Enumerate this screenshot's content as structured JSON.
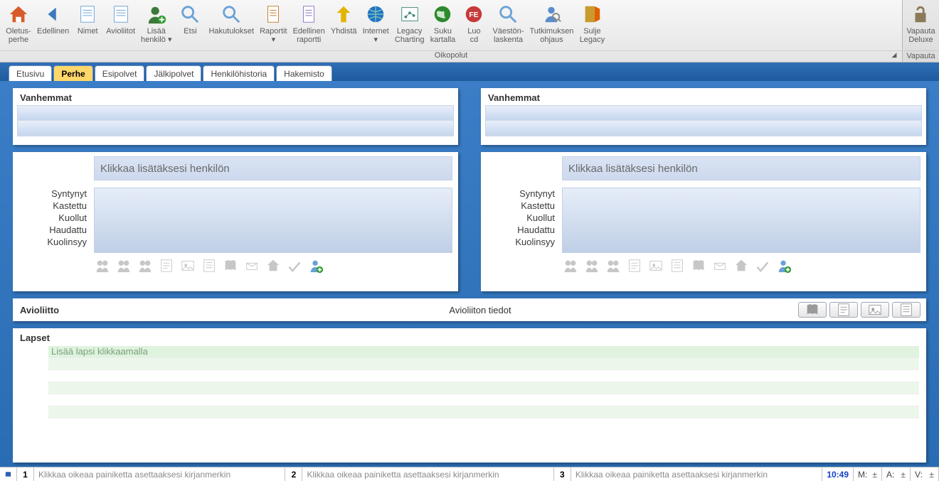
{
  "ribbon": {
    "items": [
      {
        "label": "Oletus-\nperhe",
        "icon": "home-icon",
        "fill": "#d85c2a"
      },
      {
        "label": "Edellinen",
        "icon": "back-arrow-icon",
        "fill": "#3a7abf"
      },
      {
        "label": "Nimet",
        "icon": "name-list-icon",
        "fill": "#6aa2d8"
      },
      {
        "label": "Avioliitot",
        "icon": "marriage-list-icon",
        "fill": "#6aa2d8"
      },
      {
        "label": "Lisää\nhenkilö ▾",
        "icon": "add-person-icon",
        "fill": "#3c7a3c"
      },
      {
        "label": "Etsi",
        "icon": "search-icon",
        "fill": "#6aa2d8"
      },
      {
        "label": "Hakutulokset",
        "icon": "search-results-icon",
        "fill": "#6aa2d8"
      },
      {
        "label": "Raportit\n▾",
        "icon": "reports-icon",
        "fill": "#c77b2e"
      },
      {
        "label": "Edellinen\nraportti",
        "icon": "prev-report-icon",
        "fill": "#9175c2"
      },
      {
        "label": "Yhdistä",
        "icon": "merge-icon",
        "fill": "#e2b500"
      },
      {
        "label": "Internet\n▾",
        "icon": "globe-icon",
        "fill": "#1f74c7"
      },
      {
        "label": "Legacy\nCharting",
        "icon": "charting-icon",
        "fill": "#3c8a7a"
      },
      {
        "label": "Suku\nkartalla",
        "icon": "map-icon",
        "fill": "#2c8a2c"
      },
      {
        "label": "Luo\ncd",
        "icon": "cd-icon",
        "fill": "#c53a3a"
      },
      {
        "label": "Väestön-\nlaskenta",
        "icon": "census-icon",
        "fill": "#6aa2d8"
      },
      {
        "label": "Tutkimuksen\nohjaus",
        "icon": "research-icon",
        "fill": "#5a8dce"
      },
      {
        "label": "Sulje\nLegacy",
        "icon": "exit-icon",
        "fill": "#c99a2e"
      }
    ],
    "group_label": "Oikopolut",
    "side": {
      "label": "Vapauta\nDeluxe",
      "icon": "unlock-icon",
      "footer": "Vapauta"
    }
  },
  "tabs": [
    {
      "label": "Etusivu",
      "active": false
    },
    {
      "label": "Perhe",
      "active": true
    },
    {
      "label": "Esipolvet",
      "active": false
    },
    {
      "label": "Jälkipolvet",
      "active": false
    },
    {
      "label": "Henkilöhistoria",
      "active": false
    },
    {
      "label": "Hakemisto",
      "active": false
    }
  ],
  "parents": {
    "title": "Vanhemmat"
  },
  "person": {
    "add_hint": "Klikkaa lisätäksesi henkilön",
    "fields": [
      "Syntynyt",
      "Kastettu",
      "Kuollut",
      "Haudattu",
      "Kuolinsyy"
    ],
    "toolbar_icons": [
      "siblings-icon",
      "parents-icon",
      "spouses-icon",
      "notes-icon",
      "pictures-icon",
      "events-icon",
      "sources-icon",
      "address-icon",
      "locations-icon",
      "todo-icon",
      "add-person-icon"
    ]
  },
  "marriage": {
    "title": "Avioliitto",
    "info": "Avioliiton tiedot",
    "buttons": [
      "sources-icon",
      "notes-icon",
      "pictures-icon",
      "events-icon"
    ]
  },
  "children": {
    "title": "Lapset",
    "hint": "Lisää lapsi klikkaamalla"
  },
  "statusbar": {
    "tip": "Klikkaa oikeaa painiketta asettaaksesi kirjanmerkin",
    "nums": [
      "1",
      "2",
      "3"
    ],
    "time": "10:49",
    "mini": [
      "M:",
      "A:",
      "V:"
    ],
    "pm": "±"
  }
}
